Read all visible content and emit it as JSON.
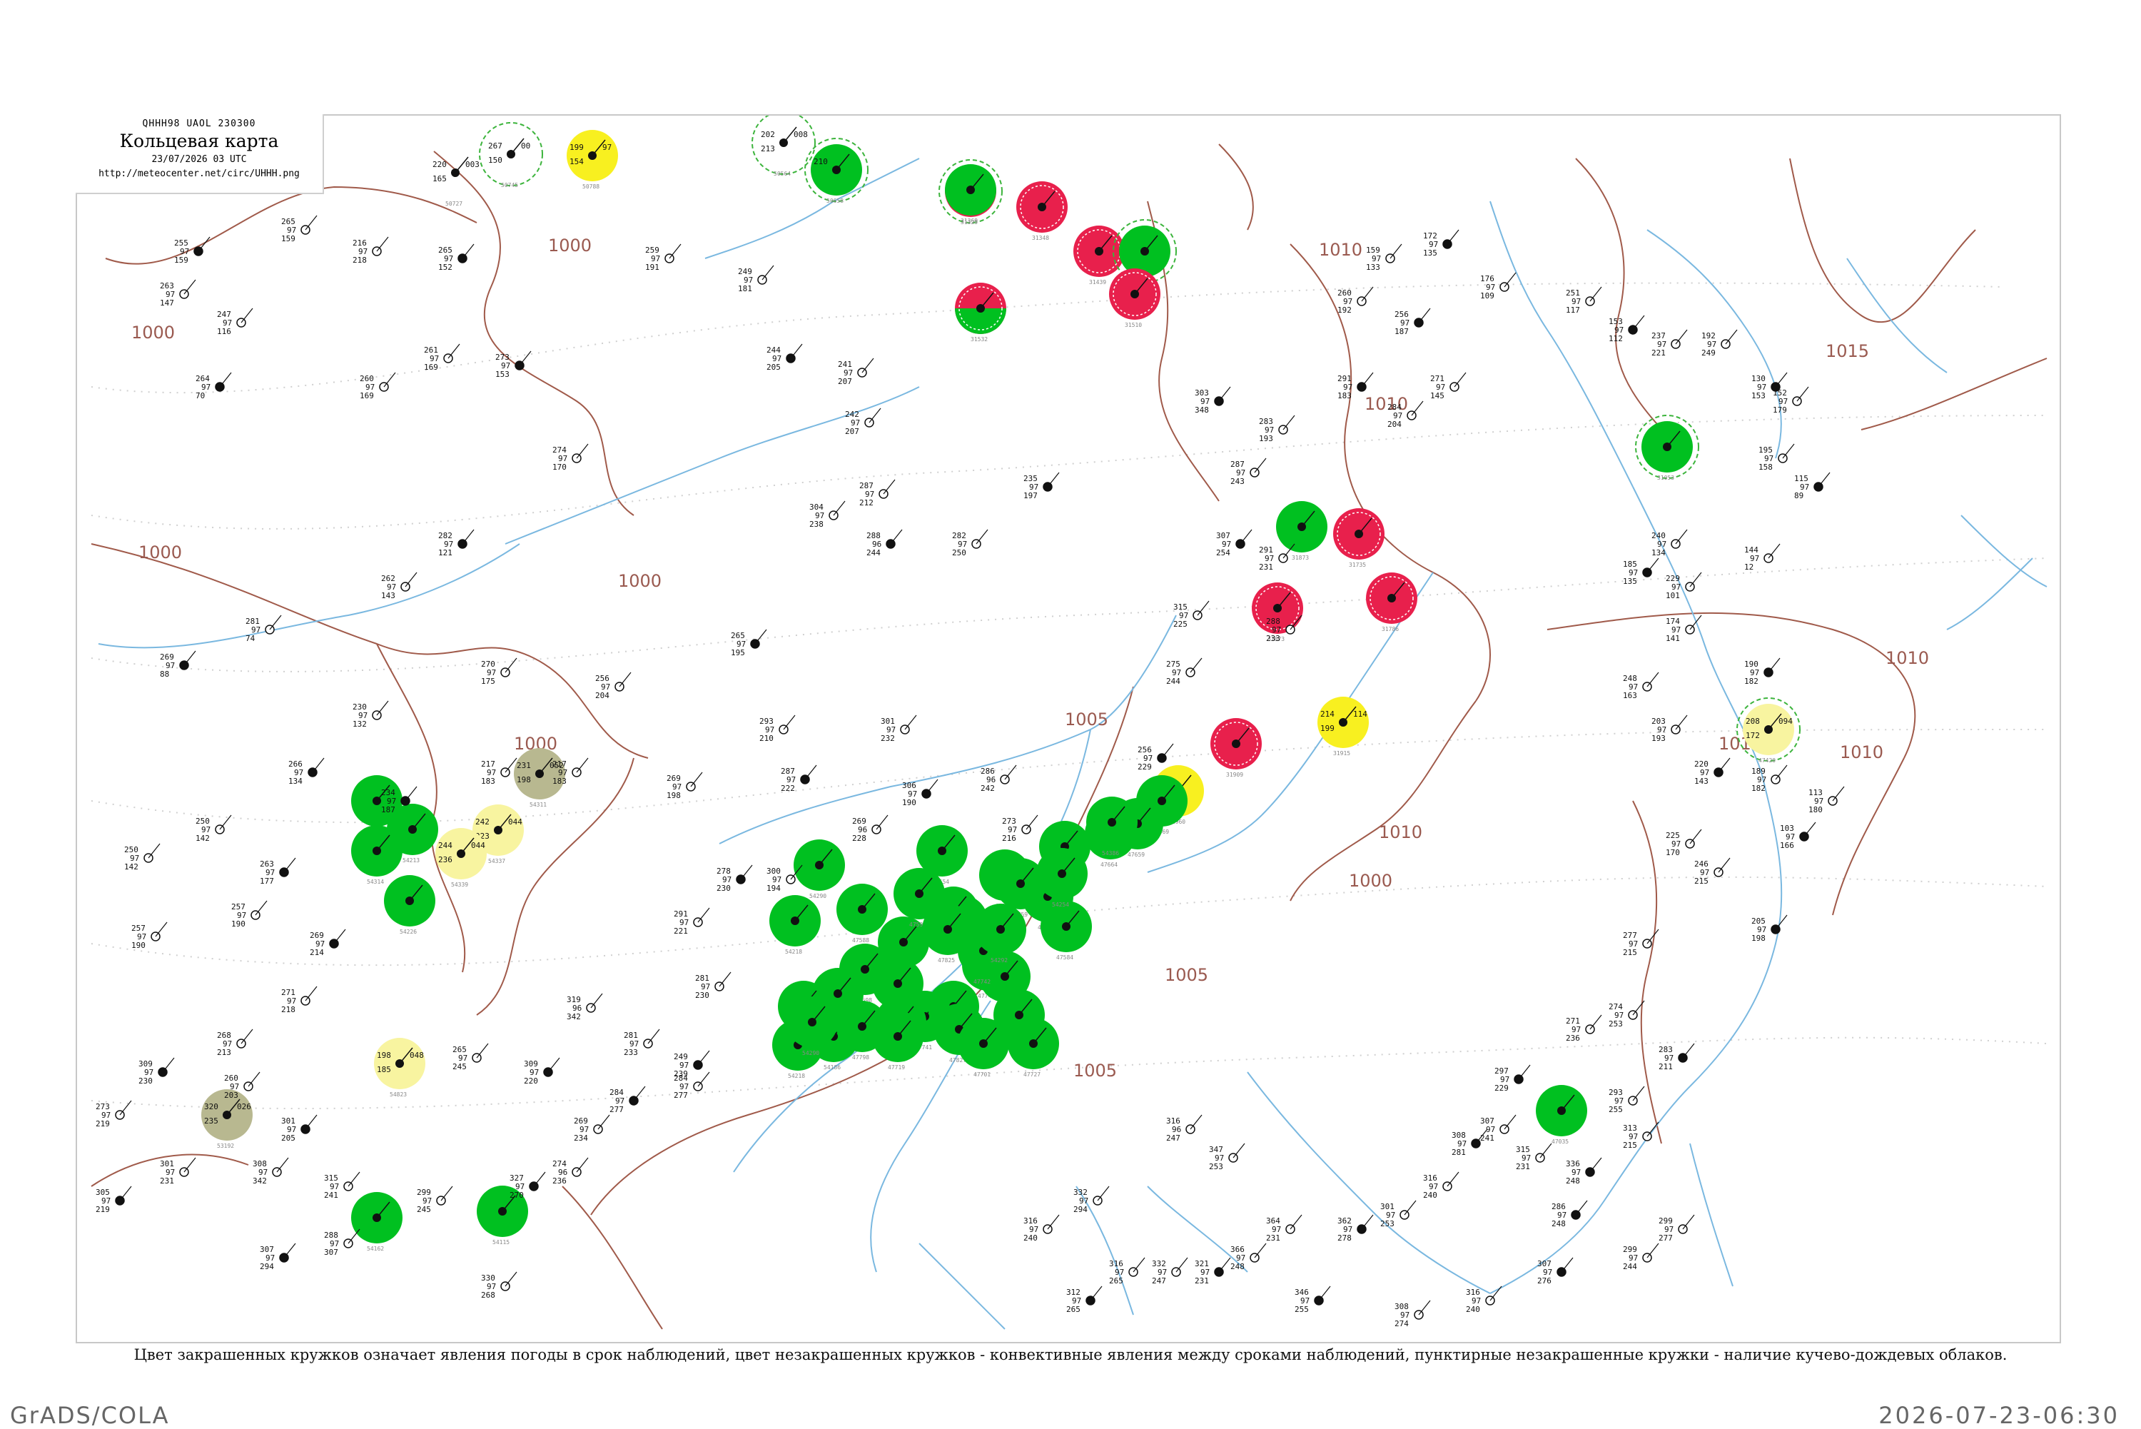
{
  "header": {
    "code": "QHHH98  UAOL  230300",
    "title": "Кольцевая карта",
    "date": "23/07/2026 03 UTC",
    "url": "http://meteocenter.net/circ/UHHH.png"
  },
  "caption": "Цвет закрашенных кружков означает явления погоды в срок наблюдений, цвет незакрашенных кружков - конвективные явления между сроками наблюдений, пунктирные незакрашенные кружки - наличие кучево-дождевых облаков.",
  "footer": {
    "left": "GrADS/COLA",
    "right": "2026-07-23-06:30"
  },
  "colors": {
    "rain": "#00c020",
    "thunder": "#e8204c",
    "fog": "#f8f020",
    "haze": "#f8f4a0",
    "dust": "#b8b890",
    "cb_ring": "#3cb43c",
    "coast": "#7ab8e0",
    "relief": "#a05a4a",
    "isobar": "#cfcfcf"
  },
  "isobar_labels": [
    "1000",
    "1000",
    "1000",
    "1000",
    "1005",
    "1005",
    "1005",
    "1010",
    "1010",
    "1010",
    "1010",
    "1010",
    "1015",
    "1000",
    "1000",
    "1010"
  ],
  "stations": [
    {
      "id": "s1",
      "t": "220",
      "p": "003",
      "td": "165",
      "kind": "none",
      "num": "50727"
    },
    {
      "id": "s2",
      "t": "267",
      "p": "00",
      "td": "150",
      "kind": "cb",
      "num": "50745"
    },
    {
      "id": "s3",
      "t": "199",
      "p": "97",
      "td": "154",
      "kind": "fog",
      "num": "50788"
    },
    {
      "id": "s4",
      "t": "202",
      "p": "008",
      "td": "213",
      "kind": "cb",
      "num": "50564"
    },
    {
      "id": "s5",
      "t": "210",
      "p": "",
      "td": "",
      "kind": "rain-cb",
      "num": "50658"
    },
    {
      "id": "s6",
      "t": "240",
      "p": "",
      "td": "",
      "kind": "thunder-cb",
      "num": "31329"
    },
    {
      "id": "s7",
      "t": "",
      "p": "",
      "td": "",
      "kind": "thunder",
      "num": "31348"
    },
    {
      "id": "s8",
      "t": "",
      "p": "",
      "td": "",
      "kind": "thunder",
      "num": "31439"
    },
    {
      "id": "s9",
      "t": "",
      "p": "",
      "td": "",
      "kind": "rain-cb",
      "num": "31468"
    },
    {
      "id": "s10",
      "t": "",
      "p": "",
      "td": "",
      "kind": "thunder",
      "num": "31510"
    },
    {
      "id": "s11",
      "t": "",
      "p": "",
      "td": "",
      "kind": "thunder-rain",
      "num": "31532"
    },
    {
      "id": "s12",
      "t": "",
      "p": "",
      "td": "",
      "kind": "thunder",
      "num": "31735"
    },
    {
      "id": "s13",
      "t": "",
      "p": "",
      "td": "",
      "kind": "thunder",
      "num": "31786"
    },
    {
      "id": "s14",
      "t": "",
      "p": "",
      "td": "",
      "kind": "thunder",
      "num": "31873"
    },
    {
      "id": "s15",
      "t": "",
      "p": "",
      "td": "",
      "kind": "thunder",
      "num": "31909"
    },
    {
      "id": "s16",
      "t": "214",
      "p": "114",
      "td": "199",
      "kind": "fog",
      "num": "31915"
    },
    {
      "id": "s17",
      "t": "208",
      "p": "094",
      "td": "172",
      "kind": "haze-cb",
      "num": "47420"
    },
    {
      "id": "s18",
      "t": "",
      "p": "",
      "td": "",
      "kind": "rain-cb",
      "num": "31053"
    },
    {
      "id": "s19",
      "t": "",
      "p": "",
      "td": "",
      "kind": "fog",
      "num": "31960"
    },
    {
      "id": "s20",
      "t": "",
      "p": "",
      "td": "",
      "kind": "rain",
      "num": "31873"
    },
    {
      "id": "s21",
      "t": "",
      "p": "",
      "td": "",
      "kind": "rain",
      "num": "47669"
    },
    {
      "id": "s22",
      "t": "",
      "p": "",
      "td": "",
      "kind": "rain",
      "num": "47664"
    },
    {
      "id": "s23",
      "t": "",
      "p": "",
      "td": "",
      "kind": "rain",
      "num": "47659"
    },
    {
      "id": "s24",
      "t": "",
      "p": "",
      "td": "",
      "kind": "rain",
      "num": "47554"
    },
    {
      "id": "s25",
      "t": "",
      "p": "",
      "td": "",
      "kind": "rain",
      "num": "47604"
    },
    {
      "id": "s26",
      "t": "",
      "p": "",
      "td": "",
      "kind": "rain",
      "num": "47636"
    },
    {
      "id": "s27",
      "t": "",
      "p": "",
      "td": "",
      "kind": "rain",
      "num": "47645"
    },
    {
      "id": "s28",
      "t": "",
      "p": "",
      "td": "",
      "kind": "rain",
      "num": "47648"
    },
    {
      "id": "s29",
      "t": "",
      "p": "",
      "td": "",
      "kind": "rain",
      "num": "47698"
    },
    {
      "id": "s30",
      "t": "",
      "p": "",
      "td": "",
      "kind": "rain",
      "num": "47620"
    },
    {
      "id": "s31",
      "t": "",
      "p": "",
      "td": "",
      "kind": "rain",
      "num": "47621"
    },
    {
      "id": "s32",
      "t": "",
      "p": "",
      "td": "",
      "kind": "rain",
      "num": "47622"
    },
    {
      "id": "s33",
      "t": "",
      "p": "",
      "td": "",
      "kind": "rain",
      "num": "47741"
    },
    {
      "id": "s34",
      "t": "",
      "p": "",
      "td": "",
      "kind": "rain",
      "num": "47747"
    },
    {
      "id": "s35",
      "t": "",
      "p": "",
      "td": "",
      "kind": "rain",
      "num": "47746"
    },
    {
      "id": "s36",
      "t": "",
      "p": "",
      "td": "",
      "kind": "rain",
      "num": "47744"
    },
    {
      "id": "s37",
      "t": "",
      "p": "",
      "td": "",
      "kind": "rain",
      "num": "47742"
    },
    {
      "id": "s38",
      "t": "",
      "p": "",
      "td": "",
      "kind": "rain",
      "num": "47759"
    },
    {
      "id": "s39",
      "t": "",
      "p": "",
      "td": "",
      "kind": "rain",
      "num": "47761"
    },
    {
      "id": "s40",
      "t": "",
      "p": "",
      "td": "",
      "kind": "rain",
      "num": "47771"
    },
    {
      "id": "s41",
      "t": "",
      "p": "",
      "td": "",
      "kind": "rain",
      "num": "47584"
    },
    {
      "id": "s42",
      "t": "",
      "p": "",
      "td": "",
      "kind": "rain",
      "num": "47588"
    },
    {
      "id": "s43",
      "t": "",
      "p": "",
      "td": "",
      "kind": "rain",
      "num": "47590"
    },
    {
      "id": "s44",
      "t": "",
      "p": "",
      "td": "",
      "kind": "rain",
      "num": "47825"
    },
    {
      "id": "s45",
      "t": "",
      "p": "",
      "td": "",
      "kind": "rain",
      "num": "47827"
    },
    {
      "id": "s46",
      "t": "",
      "p": "",
      "td": "",
      "kind": "rain",
      "num": "54096"
    },
    {
      "id": "s47",
      "t": "",
      "p": "",
      "td": "",
      "kind": "rain",
      "num": "54186"
    },
    {
      "id": "s48",
      "t": "",
      "p": "",
      "td": "",
      "kind": "rain",
      "num": "54218"
    },
    {
      "id": "s49",
      "t": "",
      "p": "",
      "td": "",
      "kind": "rain",
      "num": "54290"
    },
    {
      "id": "s50",
      "t": "",
      "p": "",
      "td": "",
      "kind": "rain",
      "num": "47798"
    },
    {
      "id": "s51",
      "t": "",
      "p": "",
      "td": "",
      "kind": "rain",
      "num": "47719"
    },
    {
      "id": "s52",
      "t": "",
      "p": "",
      "td": "",
      "kind": "rain",
      "num": "47701"
    },
    {
      "id": "s53",
      "t": "",
      "p": "",
      "td": "",
      "kind": "rain",
      "num": "47702"
    },
    {
      "id": "s54",
      "t": "",
      "p": "",
      "td": "",
      "kind": "rain",
      "num": "47727"
    },
    {
      "id": "s55",
      "t": "231",
      "p": "052",
      "td": "198",
      "kind": "dust",
      "num": "54311"
    },
    {
      "id": "s56",
      "t": "242",
      "p": "044",
      "td": "223",
      "kind": "haze",
      "num": "54337"
    },
    {
      "id": "s57",
      "t": "244",
      "p": "044",
      "td": "236",
      "kind": "haze",
      "num": "54339"
    },
    {
      "id": "s58",
      "t": "198",
      "p": "048",
      "td": "185",
      "kind": "haze",
      "num": "54823"
    },
    {
      "id": "s59",
      "t": "320",
      "p": "026",
      "td": "235",
      "kind": "dust",
      "num": "53192"
    },
    {
      "id": "s60",
      "t": "",
      "p": "",
      "td": "",
      "kind": "rain",
      "num": "54218"
    },
    {
      "id": "s61",
      "t": "",
      "p": "",
      "td": "",
      "kind": "rain",
      "num": "54213"
    },
    {
      "id": "s62",
      "t": "",
      "p": "",
      "td": "",
      "kind": "rain",
      "num": "54226"
    },
    {
      "id": "s63",
      "t": "",
      "p": "",
      "td": "",
      "kind": "rain",
      "num": "54314"
    },
    {
      "id": "s64",
      "t": "",
      "p": "",
      "td": "",
      "kind": "rain",
      "num": "54254"
    },
    {
      "id": "s65",
      "t": "",
      "p": "",
      "td": "",
      "kind": "rain",
      "num": "54292"
    },
    {
      "id": "s66",
      "t": "",
      "p": "",
      "td": "",
      "kind": "rain",
      "num": "54386"
    },
    {
      "id": "s67",
      "t": "",
      "p": "",
      "td": "",
      "kind": "rain",
      "num": "54290"
    },
    {
      "id": "s68",
      "t": "",
      "p": "",
      "td": "",
      "kind": "rain",
      "num": "54218"
    },
    {
      "id": "s69",
      "t": "",
      "p": "",
      "td": "",
      "kind": "rain",
      "num": "31369"
    },
    {
      "id": "s70",
      "t": "",
      "p": "",
      "td": "",
      "kind": "rain",
      "num": "47035"
    },
    {
      "id": "s71",
      "t": "",
      "p": "",
      "td": "",
      "kind": "rain",
      "num": "54115"
    },
    {
      "id": "s72",
      "t": "",
      "p": "",
      "td": "",
      "kind": "rain",
      "num": "54162"
    }
  ]
}
